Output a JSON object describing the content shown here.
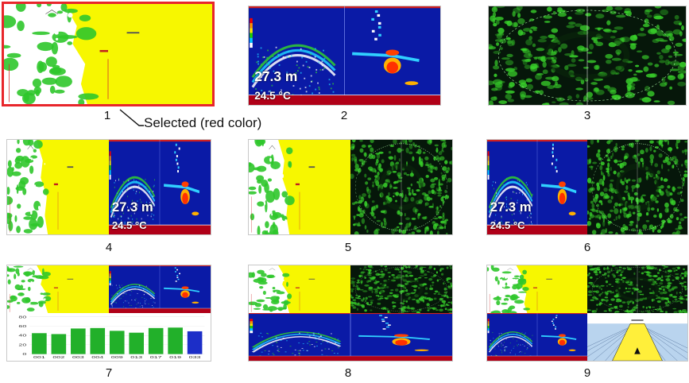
{
  "layout_labels": [
    "1",
    "2",
    "3",
    "4",
    "5",
    "6",
    "7",
    "8",
    "9"
  ],
  "callout": {
    "text": "Selected (red color)"
  },
  "sounder": {
    "depth_text": "27.3 m",
    "temp_text": "24.5 °C"
  },
  "bar_chart": {
    "ticks": [
      80,
      60,
      40,
      20,
      0
    ],
    "values": [
      45,
      43,
      55,
      56,
      50,
      46,
      56,
      57,
      49
    ],
    "axis_labels": [
      "001",
      "002",
      "003",
      "004",
      "009",
      "013",
      "017",
      "019",
      "033"
    ]
  },
  "colors": {
    "selected_border": "#e8262b",
    "map_sea": "#f7f700",
    "land": "#2fc62b",
    "sounder_bg": "#0a1aa6",
    "seabed": "#b00018",
    "radar_echo": "#38d02a",
    "bar_green": "#22b02a",
    "bar_blue": "#1c2ec8"
  }
}
